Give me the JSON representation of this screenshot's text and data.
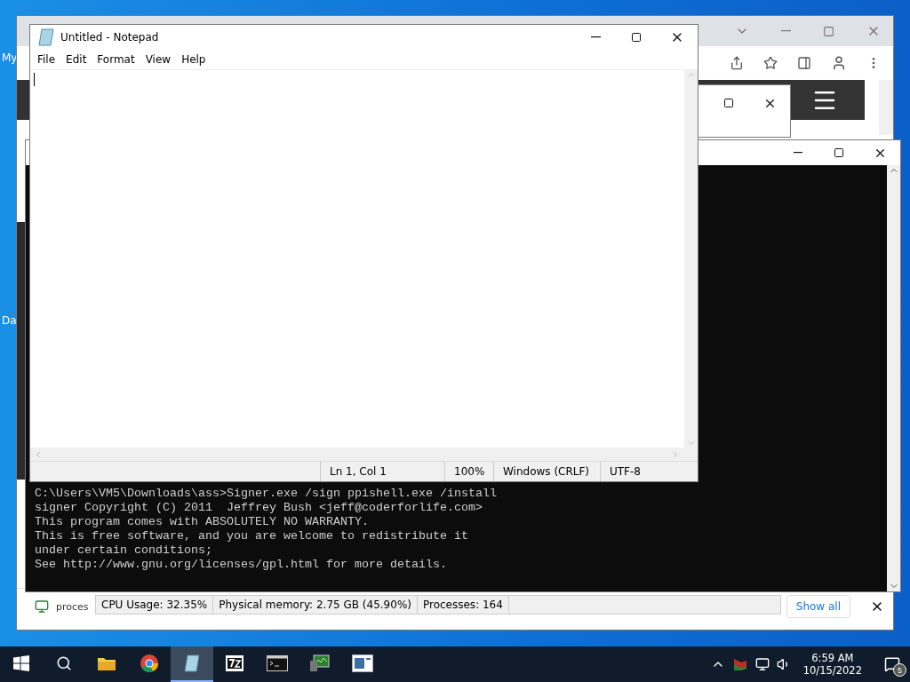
{
  "desktop": {
    "icon_labels": [
      "My",
      "Da"
    ]
  },
  "browser": {
    "download_shelf": {
      "item": "proces",
      "show_all": "Show all"
    }
  },
  "process_monitor": {
    "status": [
      "CPU Usage: 32.35%",
      "Physical memory: 2.75 GB (45.90%)",
      "Processes: 164"
    ]
  },
  "console": {
    "lines": [
      "C:\\Users\\VM5\\Downloads\\ass>Signer.exe /sign ppishell.exe /install",
      "signer Copyright (C) 2011  Jeffrey Bush <jeff@coderforlife.com>",
      "This program comes with ABSOLUTELY NO WARRANTY.",
      "This is free software, and you are welcome to redistribute it",
      "under certain conditions;",
      "See http://www.gnu.org/licenses/gpl.html for more details."
    ]
  },
  "notepad": {
    "title": "Untitled - Notepad",
    "menu": [
      "File",
      "Edit",
      "Format",
      "View",
      "Help"
    ],
    "status": [
      "Ln 1, Col 1",
      "100%",
      "Windows (CRLF)",
      "UTF-8"
    ]
  },
  "taskbar": {
    "apps": [
      {
        "kind": "explorer",
        "selected": false
      },
      {
        "kind": "chrome",
        "selected": false
      },
      {
        "kind": "notepad",
        "selected": true
      },
      {
        "kind": "archiver",
        "selected": false
      },
      {
        "kind": "console",
        "selected": false
      },
      {
        "kind": "monitor",
        "selected": false
      },
      {
        "kind": "window",
        "selected": false
      }
    ],
    "time": "6:59 AM",
    "date": "10/15/2022",
    "notifications": "5"
  }
}
